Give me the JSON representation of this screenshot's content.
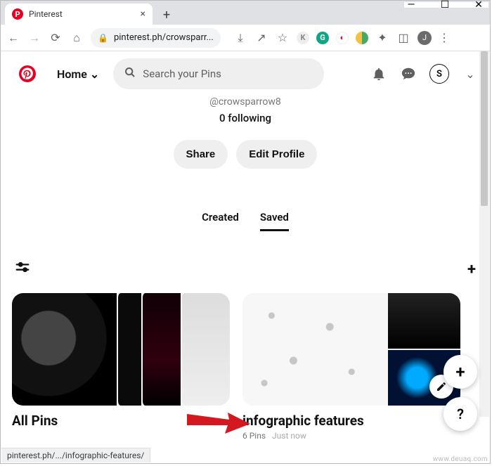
{
  "window": {
    "tab_title": "Pinterest",
    "min_glyph": "—",
    "max_glyph": "☐",
    "close_glyph": "✕",
    "newtab_glyph": "+"
  },
  "addrbar": {
    "url_display": "pinterest.ph/crowsparr...",
    "avatar_initial": "J"
  },
  "pin_header": {
    "home_label": "Home",
    "search_placeholder": "Search your Pins",
    "account_initial": "S"
  },
  "profile": {
    "handle": "@crowsparrow8",
    "following_text": "0 following",
    "share_label": "Share",
    "edit_profile_label": "Edit Profile"
  },
  "tabs": {
    "created_label": "Created",
    "saved_label": "Saved",
    "active": "saved"
  },
  "boards": {
    "all_pins": {
      "title": "All Pins"
    },
    "infographic": {
      "title": "infographic features",
      "count_text": "6 Pins",
      "time_text": "Just now"
    }
  },
  "floating": {
    "add_glyph": "+",
    "help_glyph": "?"
  },
  "statusbar": {
    "text": "pinterest.ph/.../infographic-features/"
  },
  "watermark": "www.deuaq.com"
}
